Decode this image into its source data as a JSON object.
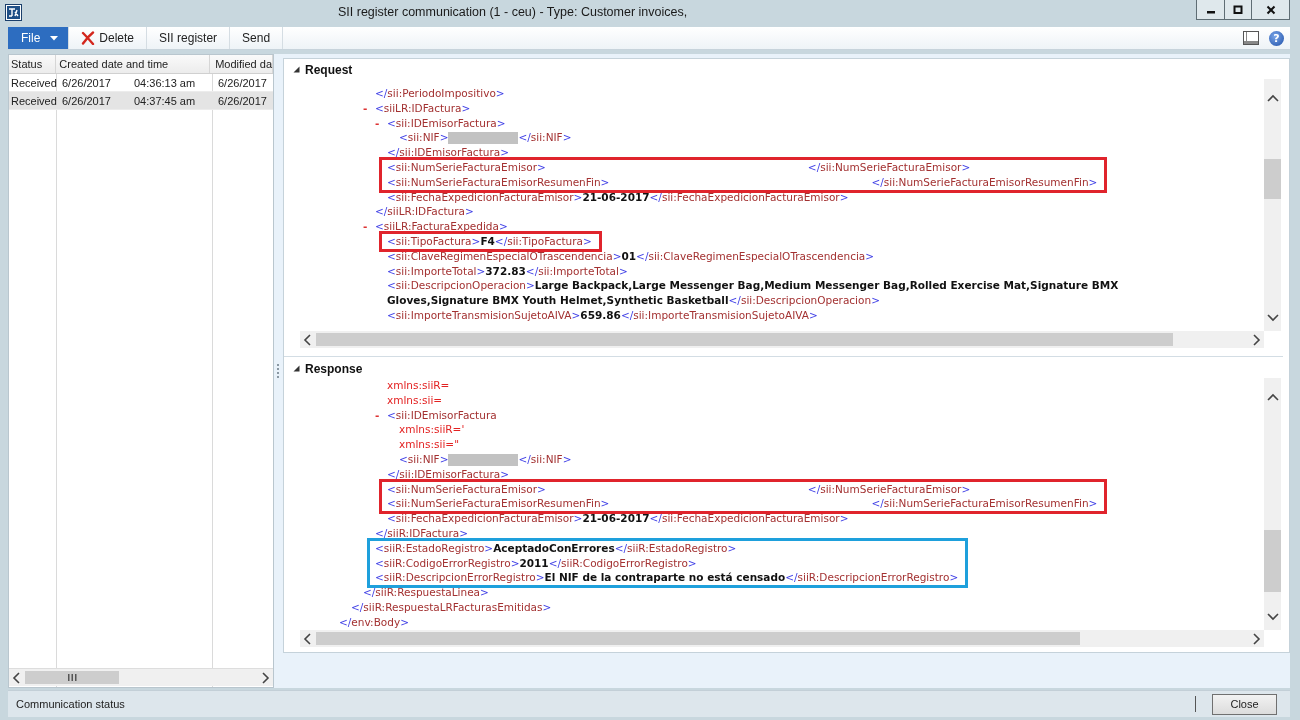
{
  "window": {
    "title": "SII register communication (1 - ceu) - Type: Customer invoices,"
  },
  "toolbar": {
    "buttons": [
      {
        "kind": "menu",
        "label": "File"
      },
      {
        "kind": "delete",
        "label": "Delete"
      },
      {
        "kind": "plain",
        "label": "SII register"
      },
      {
        "kind": "plain",
        "label": "Send"
      }
    ],
    "help": "?"
  },
  "grid": {
    "columns": [
      "Status",
      "Created date and time",
      "Modified da"
    ],
    "rows": [
      {
        "status": "Received",
        "created_date": "6/26/2017",
        "created_time": "04:36:13 am",
        "modified": "6/26/2017",
        "selected": false
      },
      {
        "status": "Received",
        "created_date": "6/26/2017",
        "created_time": "04:37:45 am",
        "modified": "6/26/2017",
        "selected": true
      }
    ]
  },
  "sections": [
    {
      "title": "Request",
      "expanded": true,
      "lines": [
        {
          "kind": "line",
          "segments": [
            {
              "kind": "tag",
              "open": "</",
              "name": "sii:PeriodoImpositivo",
              "end": ">"
            }
          ]
        },
        {
          "kind": "element",
          "toggle": "-",
          "open": [
            {
              "kind": "tag",
              "open": "<",
              "name": "siiLR:IDFactura",
              "end": ">"
            }
          ],
          "children": [
            {
              "kind": "element",
              "toggle": "-",
              "open": [
                {
                  "kind": "tag",
                  "open": "<",
                  "name": "sii:IDEmisorFactura",
                  "end": ">"
                }
              ],
              "children": [
                {
                  "kind": "line",
                  "segments": [
                    {
                      "kind": "tag",
                      "open": "<",
                      "name": "sii:NIF",
                      "end": ">"
                    },
                    {
                      "kind": "redacted"
                    },
                    {
                      "kind": "tag",
                      "open": "</",
                      "name": "sii:NIF",
                      "end": ">"
                    }
                  ]
                }
              ],
              "close": [
                {
                  "kind": "tag",
                  "open": "</",
                  "name": "sii:IDEmisorFactura",
                  "end": ">"
                }
              ]
            },
            {
              "kind": "box",
              "color": "#e0242c",
              "children": [
                {
                  "kind": "line",
                  "segments": [
                    {
                      "kind": "tag",
                      "open": "<",
                      "name": "sii:NumSerieFacturaEmisor",
                      "end": ">"
                    },
                    {
                      "kind": "blank"
                    },
                    {
                      "kind": "tag",
                      "open": "</",
                      "name": "sii:NumSerieFacturaEmisor",
                      "end": ">"
                    }
                  ]
                },
                {
                  "kind": "line",
                  "segments": [
                    {
                      "kind": "tag",
                      "open": "<",
                      "name": "sii:NumSerieFacturaEmisorResumenFin",
                      "end": ">"
                    },
                    {
                      "kind": "blank"
                    },
                    {
                      "kind": "tag",
                      "open": "</",
                      "name": "sii:NumSerieFacturaEmisorResumenFin",
                      "end": ">"
                    }
                  ]
                }
              ]
            },
            {
              "kind": "line",
              "segments": [
                {
                  "kind": "tag",
                  "open": "<",
                  "name": "sii:FechaExpedicionFacturaEmisor",
                  "end": ">"
                },
                {
                  "kind": "value",
                  "text": "21-06-2017"
                },
                {
                  "kind": "tag",
                  "open": "</",
                  "name": "sii:FechaExpedicionFacturaEmisor",
                  "end": ">"
                }
              ]
            }
          ],
          "close": [
            {
              "kind": "tag",
              "open": "</",
              "name": "siiLR:IDFactura",
              "end": ">"
            }
          ]
        },
        {
          "kind": "element",
          "toggle": "-",
          "open": [
            {
              "kind": "tag",
              "open": "<",
              "name": "siiLR:FacturaExpedida",
              "end": ">"
            }
          ],
          "children": [
            {
              "kind": "box",
              "color": "#e0242c",
              "children": [
                {
                  "kind": "line",
                  "segments": [
                    {
                      "kind": "tag",
                      "open": "<",
                      "name": "sii:TipoFactura",
                      "end": ">"
                    },
                    {
                      "kind": "value",
                      "text": "F4"
                    },
                    {
                      "kind": "tag",
                      "open": "</",
                      "name": "sii:TipoFactura",
                      "end": ">"
                    }
                  ]
                }
              ]
            },
            {
              "kind": "line",
              "segments": [
                {
                  "kind": "tag",
                  "open": "<",
                  "name": "sii:ClaveRegimenEspecialOTrascendencia",
                  "end": ">"
                },
                {
                  "kind": "value",
                  "text": "01"
                },
                {
                  "kind": "tag",
                  "open": "</",
                  "name": "sii:ClaveRegimenEspecialOTrascendencia",
                  "end": ">"
                }
              ]
            },
            {
              "kind": "line",
              "segments": [
                {
                  "kind": "tag",
                  "open": "<",
                  "name": "sii:ImporteTotal",
                  "end": ">"
                },
                {
                  "kind": "value",
                  "text": "372.83"
                },
                {
                  "kind": "tag",
                  "open": "</",
                  "name": "sii:ImporteTotal",
                  "end": ">"
                }
              ]
            },
            {
              "kind": "line",
              "segments": [
                {
                  "kind": "tag",
                  "open": "<",
                  "name": "sii:DescripcionOperacion",
                  "end": ">"
                },
                {
                  "kind": "value",
                  "text": "Large Backpack,Large Messenger Bag,Medium Messenger Bag,Rolled Exercise Mat,Signature BMX Gloves,Signature BMX Youth Helmet,Synthetic Basketball"
                },
                {
                  "kind": "tag",
                  "open": "</",
                  "name": "sii:DescripcionOperacion",
                  "end": ">"
                }
              ]
            },
            {
              "kind": "line",
              "segments": [
                {
                  "kind": "tag",
                  "open": "<",
                  "name": "sii:ImporteTransmisionSujetoAIVA",
                  "end": ">"
                },
                {
                  "kind": "value",
                  "text": "659.86"
                },
                {
                  "kind": "tag",
                  "open": "</",
                  "name": "sii:ImporteTransmisionSujetoAIVA",
                  "end": ">"
                }
              ]
            }
          ]
        }
      ]
    },
    {
      "title": "Response",
      "expanded": true,
      "lines": [
        {
          "kind": "element",
          "children": [
            {
              "kind": "element",
              "children": [
                {
                  "kind": "element",
                  "children": [
                    {
                      "kind": "element",
                      "children": [
                        {
                          "kind": "line",
                          "segments": [
                            {
                              "kind": "attr",
                              "text": "xmlns:siiR="
                            }
                          ]
                        },
                        {
                          "kind": "line",
                          "segments": [
                            {
                              "kind": "attr",
                              "text": "xmlns:sii="
                            }
                          ]
                        },
                        {
                          "kind": "element",
                          "toggle": "-",
                          "open": [
                            {
                              "kind": "tag",
                              "open": "<",
                              "name": "sii:IDEmisorFactura"
                            }
                          ],
                          "children": [
                            {
                              "kind": "line",
                              "segments": [
                                {
                                  "kind": "attr",
                                  "text": "xmlns:siiR='"
                                }
                              ]
                            },
                            {
                              "kind": "line",
                              "segments": [
                                {
                                  "kind": "attr",
                                  "text": "xmlns:sii=\""
                                }
                              ]
                            },
                            {
                              "kind": "line",
                              "segments": [
                                {
                                  "kind": "tag",
                                  "open": "<",
                                  "name": "sii:NIF",
                                  "end": ">"
                                },
                                {
                                  "kind": "redacted"
                                },
                                {
                                  "kind": "tag",
                                  "open": "</",
                                  "name": "sii:NIF",
                                  "end": ">"
                                }
                              ]
                            }
                          ],
                          "close": [
                            {
                              "kind": "tag",
                              "open": "</",
                              "name": "sii:IDEmisorFactura",
                              "end": ">"
                            }
                          ]
                        },
                        {
                          "kind": "box",
                          "color": "#e0242c",
                          "children": [
                            {
                              "kind": "line",
                              "segments": [
                                {
                                  "kind": "tag",
                                  "open": "<",
                                  "name": "sii:NumSerieFacturaEmisor",
                                  "end": ">"
                                },
                                {
                                  "kind": "blank"
                                },
                                {
                                  "kind": "tag",
                                  "open": "</",
                                  "name": "sii:NumSerieFacturaEmisor",
                                  "end": ">"
                                }
                              ]
                            },
                            {
                              "kind": "line",
                              "segments": [
                                {
                                  "kind": "tag",
                                  "open": "<",
                                  "name": "sii:NumSerieFacturaEmisorResumenFin",
                                  "end": ">"
                                },
                                {
                                  "kind": "blank"
                                },
                                {
                                  "kind": "tag",
                                  "open": "</",
                                  "name": "sii:NumSerieFacturaEmisorResumenFin",
                                  "end": ">"
                                }
                              ]
                            }
                          ]
                        },
                        {
                          "kind": "line",
                          "segments": [
                            {
                              "kind": "tag",
                              "open": "<",
                              "name": "sii:FechaExpedicionFacturaEmisor",
                              "end": ">"
                            },
                            {
                              "kind": "value",
                              "text": "21-06-2017"
                            },
                            {
                              "kind": "tag",
                              "open": "</",
                              "name": "sii:FechaExpedicionFacturaEmisor",
                              "end": ">"
                            }
                          ]
                        }
                      ],
                      "close": [
                        {
                          "kind": "tag",
                          "open": "</",
                          "name": "siiR:IDFactura",
                          "end": ">"
                        }
                      ]
                    },
                    {
                      "kind": "box",
                      "color": "#1ea0dc",
                      "children": [
                        {
                          "kind": "line",
                          "segments": [
                            {
                              "kind": "tag",
                              "open": "<",
                              "name": "siiR:EstadoRegistro",
                              "end": ">"
                            },
                            {
                              "kind": "value",
                              "text": "AceptadoConErrores"
                            },
                            {
                              "kind": "tag",
                              "open": "</",
                              "name": "siiR:EstadoRegistro",
                              "end": ">"
                            }
                          ]
                        },
                        {
                          "kind": "line",
                          "segments": [
                            {
                              "kind": "tag",
                              "open": "<",
                              "name": "siiR:CodigoErrorRegistro",
                              "end": ">"
                            },
                            {
                              "kind": "value",
                              "text": "2011"
                            },
                            {
                              "kind": "tag",
                              "open": "</",
                              "name": "siiR:CodigoErrorRegistro",
                              "end": ">"
                            }
                          ]
                        },
                        {
                          "kind": "line",
                          "segments": [
                            {
                              "kind": "tag",
                              "open": "<",
                              "name": "siiR:DescripcionErrorRegistro",
                              "end": ">"
                            },
                            {
                              "kind": "value",
                              "text": "El NIF de la contraparte no está censado"
                            },
                            {
                              "kind": "tag",
                              "open": "</",
                              "name": "siiR:DescripcionErrorRegistro",
                              "end": ">"
                            }
                          ]
                        }
                      ]
                    }
                  ],
                  "close": [
                    {
                      "kind": "tag",
                      "open": "</",
                      "name": "siiR:RespuestaLinea",
                      "end": ">"
                    }
                  ]
                }
              ],
              "close": [
                {
                  "kind": "tag",
                  "open": "</",
                  "name": "siiR:RespuestaLRFacturasEmitidas",
                  "end": ">"
                }
              ]
            }
          ],
          "close": [
            {
              "kind": "tag",
              "open": "</",
              "name": "env:Body",
              "end": ">"
            }
          ]
        }
      ]
    }
  ],
  "status_bar": {
    "text": "Communication status",
    "close_button": "Close"
  }
}
